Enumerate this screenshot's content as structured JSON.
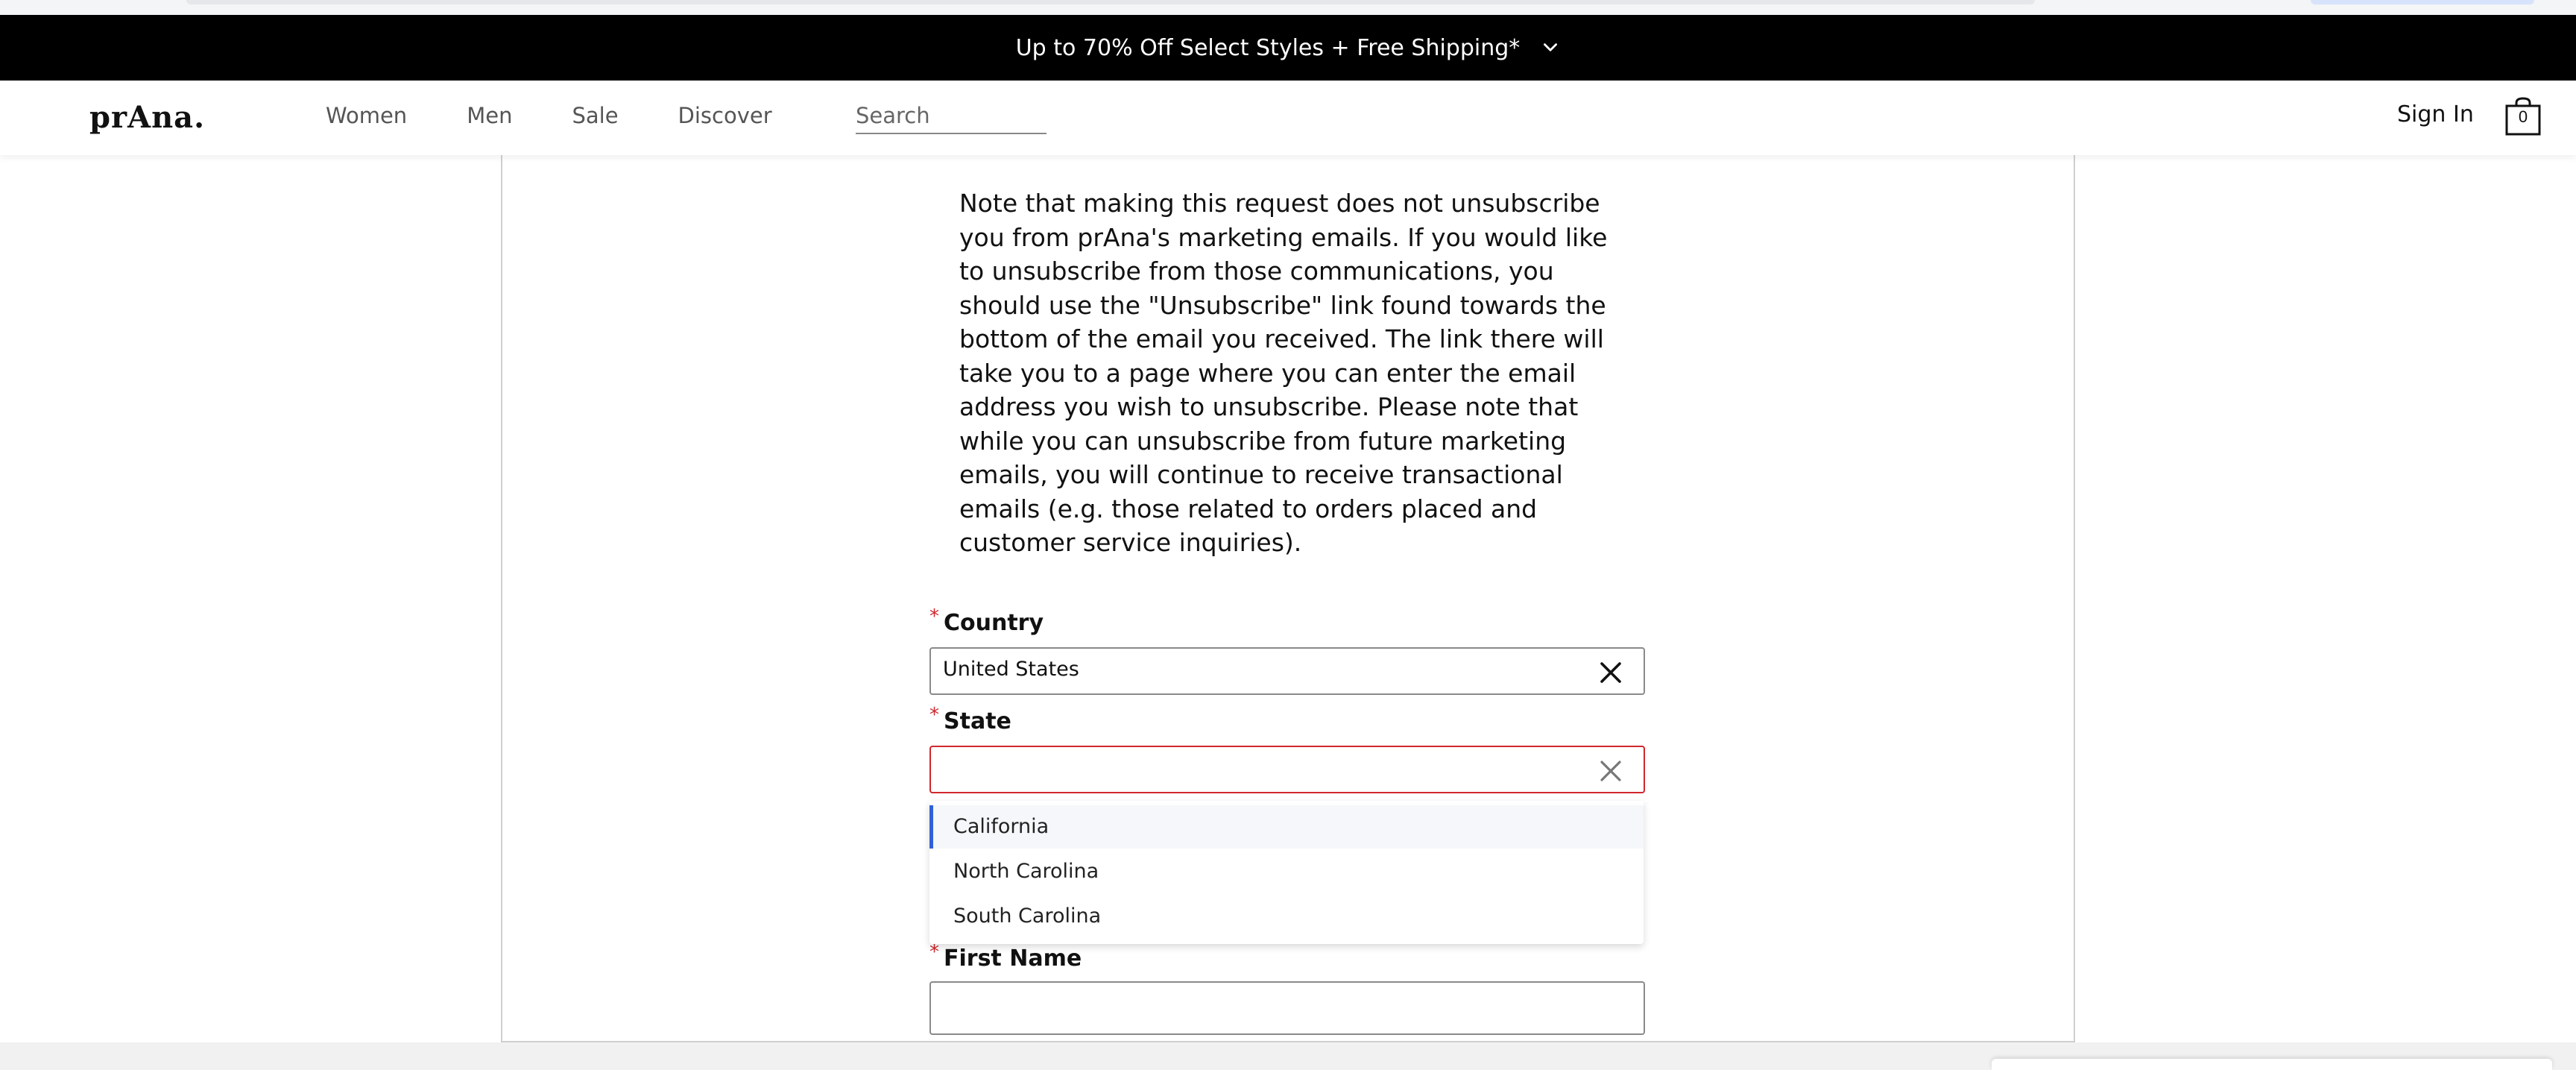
{
  "promo": {
    "text": "Up to 70% Off Select Styles + Free Shipping*"
  },
  "header": {
    "logo": "prAna.",
    "nav": [
      "Women",
      "Men",
      "Sale",
      "Discover"
    ],
    "search_placeholder": "Search",
    "signin": "Sign In",
    "cart_count": "0"
  },
  "note": "Note that making this request does not unsubscribe you from prAna's marketing emails. If you would like to unsubscribe from those communications, you should use the \"Unsubscribe\" link found towards the bottom of the email you received. The link there will take you to a page where you can enter the email address you wish to unsubscribe. Please note that while you can unsubscribe from future marketing emails, you will continue to receive transactional emails (e.g. those related to orders placed and customer service inquiries).",
  "form": {
    "required_mark": "*",
    "country": {
      "label": "Country",
      "value": "United States"
    },
    "state": {
      "label": "State",
      "value": "",
      "options": [
        "California",
        "North Carolina",
        "South Carolina"
      ]
    },
    "first_name": {
      "label": "First Name",
      "value": ""
    }
  }
}
